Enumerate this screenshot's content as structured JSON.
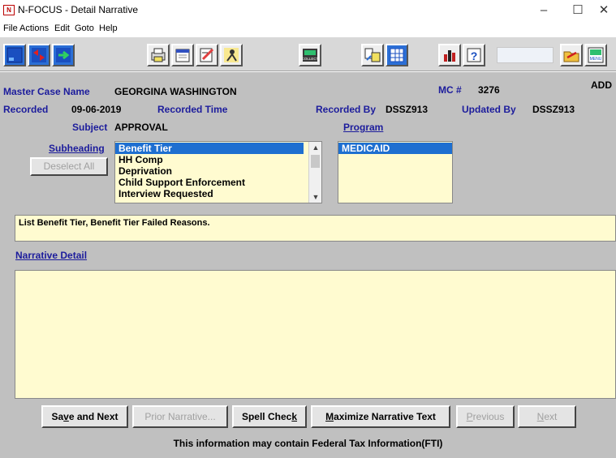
{
  "window": {
    "title": "N-FOCUS - Detail Narrative",
    "app_icon_text": "N",
    "minimize_glyph": "–",
    "maximize_glyph": "☐",
    "close_glyph": "✕"
  },
  "menu": [
    "File",
    "Actions",
    "Edit",
    "Goto",
    "Help"
  ],
  "toolbar": {
    "icons": [
      "blue-window-icon",
      "back-forward-icon",
      "exit-arrow-icon",
      "printer-icon",
      "calendar-icon",
      "edit-note-icon",
      "person-action-icon",
      "collect-icon",
      "folder-compare-icon",
      "grid-icon",
      "bar-chart-icon",
      "help-icon",
      "open-folder-icon",
      "menu-icon"
    ],
    "collect_label": "COLLECT",
    "menu_label": "MENU"
  },
  "header": {
    "master_case_name_label": "Master Case Name",
    "master_case_name": "GEORGINA WASHINGTON",
    "mc_label": "MC #",
    "mc_number": "3276",
    "mode": "ADD",
    "recorded_label": "Recorded",
    "recorded_date": "09-06-2019",
    "recorded_time_label": "Recorded Time",
    "recorded_by_label": "Recorded By",
    "recorded_by": "DSSZ913",
    "updated_by_label": "Updated By",
    "updated_by": "DSSZ913",
    "subject_label": "Subject",
    "subject": "APPROVAL",
    "program_label": "Program"
  },
  "subheading": {
    "label": "Subheading",
    "deselect_all": "Deselect All",
    "items": [
      "Benefit Tier",
      "HH Comp",
      "Deprivation",
      "Child Support Enforcement",
      "Interview Requested"
    ],
    "selected_index": 0
  },
  "program": {
    "items": [
      "MEDICAID"
    ],
    "selected_index": 0
  },
  "description": "List Benefit Tier, Benefit Tier Failed Reasons.",
  "narrative": {
    "label": "Narrative Detail",
    "text": ""
  },
  "buttons": {
    "save_and_next_pre": "Sa",
    "save_and_next_key": "v",
    "save_and_next_post": "e and Next",
    "prior_narrative": "Prior Narrative...",
    "spell_check_pre": "Spell Chec",
    "spell_check_key": "k",
    "maximize_key": "M",
    "maximize_post": "aximize Narrative Text",
    "previous_key": "P",
    "previous_post": "revious",
    "next_key": "N",
    "next_post": "ext"
  },
  "footer": "This information may contain Federal Tax Information(FTI)",
  "colors": {
    "label_blue": "#1c1c9c",
    "form_bg": "#c0c0c0",
    "field_yellow": "#fffbd0",
    "selection_blue": "#1e6fd0"
  }
}
